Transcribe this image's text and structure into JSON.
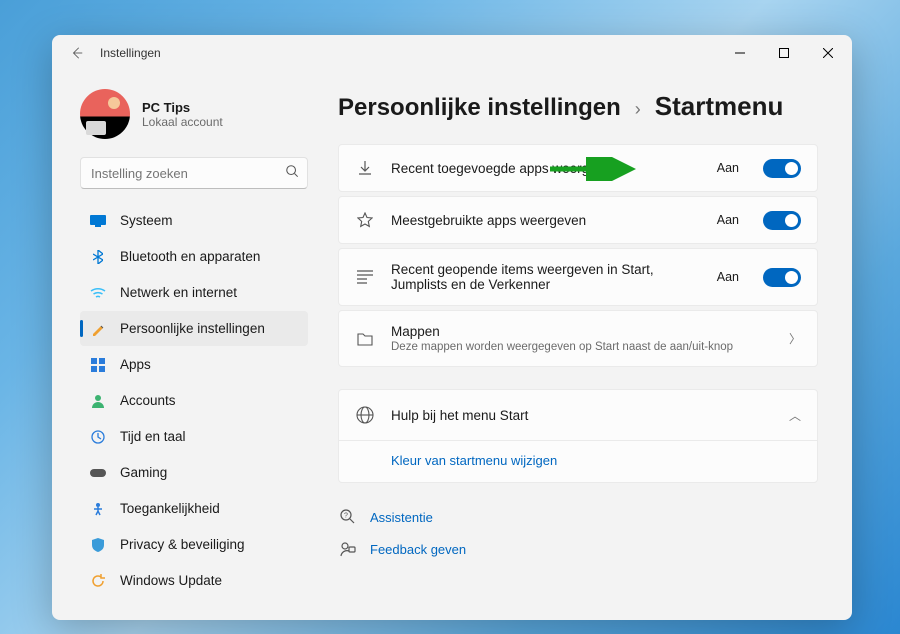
{
  "titlebar": {
    "title": "Instellingen"
  },
  "user": {
    "name": "PC Tips",
    "type": "Lokaal account"
  },
  "search": {
    "placeholder": "Instelling zoeken"
  },
  "nav": {
    "systeem": "Systeem",
    "bluetooth": "Bluetooth en apparaten",
    "network": "Netwerk en internet",
    "personal": "Persoonlijke instellingen",
    "apps": "Apps",
    "accounts": "Accounts",
    "time": "Tijd en taal",
    "gaming": "Gaming",
    "access": "Toegankelijkheid",
    "privacy": "Privacy & beveiliging",
    "update": "Windows Update"
  },
  "crumbs": {
    "parent": "Persoonlijke instellingen",
    "sep": "›",
    "current": "Startmenu"
  },
  "settings": {
    "recentApps": {
      "title": "Recent toegevoegde apps weergeven",
      "state": "Aan"
    },
    "mostUsed": {
      "title": "Meestgebruikte apps weergeven",
      "state": "Aan"
    },
    "recentItems": {
      "title": "Recent geopende items weergeven in Start, Jumplists en de Verkenner",
      "state": "Aan"
    },
    "folders": {
      "title": "Mappen",
      "sub": "Deze mappen worden weergegeven op Start naast de aan/uit-knop"
    }
  },
  "help": {
    "title": "Hulp bij het menu Start",
    "link": "Kleur van startmenu wijzigen"
  },
  "footer": {
    "assist": "Assistentie",
    "feedback": "Feedback geven"
  },
  "colors": {
    "accent": "#0067c0"
  }
}
